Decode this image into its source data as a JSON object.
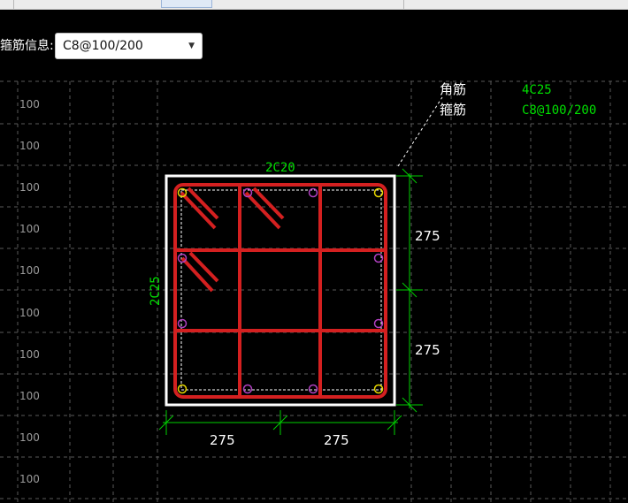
{
  "toolbar": {
    "items": [
      "…",
      "…",
      "…",
      "…",
      "…",
      "…",
      "…"
    ]
  },
  "property": {
    "label": "箍筋信息:",
    "combo_value": "C8@100/200"
  },
  "drawing": {
    "grid_labels": [
      "100",
      "100",
      "100",
      "100",
      "100",
      "100",
      "100",
      "100",
      "100",
      "100"
    ],
    "top_rebar_label": "2C20",
    "side_rebar_label": "2C25",
    "corner_rebar_label": "角筋",
    "corner_rebar_value": "4C25",
    "stirrup_label": "箍筋",
    "stirrup_value": "C8@100/200",
    "dim_right_top": "275",
    "dim_right_bottom": "275",
    "dim_bottom_left": "275",
    "dim_bottom_right": "275"
  },
  "colors": {
    "background": "#000000",
    "rebar": "#d42020",
    "dimension": "#00d000",
    "annotation_green": "#00e000",
    "outline": "#ffffff",
    "grid": "#5a5a5a",
    "corner_bar": "#e8d800",
    "side_bar": "#b040c0"
  }
}
